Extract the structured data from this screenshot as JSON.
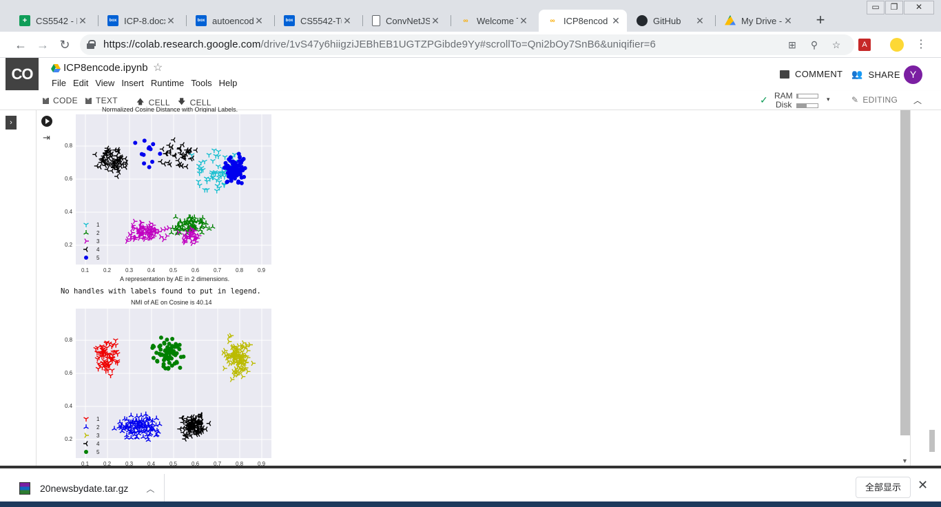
{
  "tabs": [
    {
      "title": "CS5542 - B",
      "icon": "sheets-icon",
      "color": "#0f9d58",
      "glyph": "+"
    },
    {
      "title": "ICP-8.docx",
      "icon": "box-icon",
      "color": "#0061d5",
      "glyph": "box"
    },
    {
      "title": "autoencod",
      "icon": "box-icon",
      "color": "#0061d5",
      "glyph": "box"
    },
    {
      "title": "CS5542-Tu",
      "icon": "box-icon",
      "color": "#0061d5",
      "glyph": "box"
    },
    {
      "title": "ConvNetJS",
      "icon": "page-icon",
      "color": "#ffffff",
      "glyph": ""
    },
    {
      "title": "Welcome T",
      "icon": "colab-icon",
      "color": "#f9ab00",
      "glyph": "co"
    },
    {
      "title": "ICP8encod",
      "icon": "colab-icon",
      "color": "#f9ab00",
      "glyph": "co"
    },
    {
      "title": "GitHub",
      "icon": "github-icon",
      "color": "#24292e",
      "glyph": "●"
    },
    {
      "title": "My Drive -",
      "icon": "drive-icon",
      "color": "#fbbc04",
      "glyph": "▲"
    }
  ],
  "active_tab": 6,
  "window_controls": {
    "minimize": "▭",
    "maximize": "❐",
    "close": "✕"
  },
  "address": {
    "host": "https://colab.research.google.com",
    "path": "/drive/1vS47y6hiigziJEBhEB1UGTZPGibde9Yy#scrollTo=Qni2bOy7SnB6&uniqifier=6"
  },
  "colab": {
    "logo": "CO",
    "notebook_name": "ICP8encode.ipynb",
    "menu": [
      "File",
      "Edit",
      "View",
      "Insert",
      "Runtime",
      "Tools",
      "Help"
    ],
    "comment_label": "COMMENT",
    "share_label": "SHARE",
    "avatar_letter": "Y",
    "toolbar": {
      "code": "CODE",
      "text": "TEXT",
      "cell_up": "CELL",
      "cell_down": "CELL",
      "ram": "RAM",
      "disk": "Disk",
      "ram_level": 0.05,
      "disk_level": 0.45,
      "editing": "EDITING"
    }
  },
  "output": {
    "plot1": {
      "title_partial": "Normalized Cosine Distance with Original Labels.",
      "xlabel": "A representation by AE in 2 dimensions.",
      "yticks": [
        "0.8",
        "0.6",
        "0.4",
        "0.2"
      ],
      "xticks": [
        "0.1",
        "0.2",
        "0.3",
        "0.4",
        "0.5",
        "0.6",
        "0.7",
        "0.8",
        "0.9"
      ],
      "legend": [
        "1",
        "2",
        "3",
        "4",
        "5"
      ],
      "colors": [
        "#17becf",
        "#008000",
        "#c000c0",
        "#000000",
        "#0000ee"
      ]
    },
    "warning": "No handles with labels found to put in legend.",
    "plot2": {
      "title": "NMI of AE on Cosine is 40.14",
      "yticks": [
        "0.8",
        "0.6",
        "0.4",
        "0.2"
      ],
      "xticks": [
        "0.1",
        "0.2",
        "0.3",
        "0.4",
        "0.5",
        "0.6",
        "0.7",
        "0.8",
        "0.9"
      ],
      "legend": [
        "1",
        "2",
        "3",
        "4",
        "5"
      ],
      "colors": [
        "#ee0000",
        "#0000ee",
        "#bbbb00",
        "#000000",
        "#008000"
      ]
    }
  },
  "download": {
    "filename": "20newsbydate.tar.gz",
    "show_all": "全部显示"
  }
}
